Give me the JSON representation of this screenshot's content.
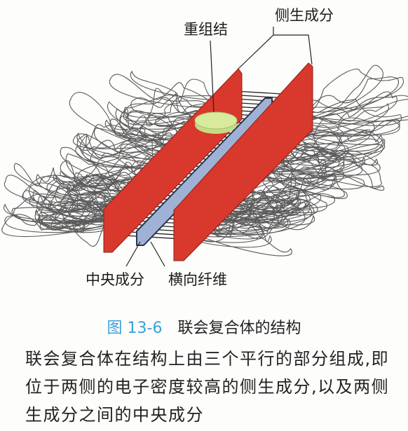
{
  "labels": {
    "recombination_nodule": "重组结",
    "lateral_element": "侧生成分",
    "central_element": "中央成分",
    "transverse_filaments": "横向纤维"
  },
  "caption": {
    "number": "图 13-6",
    "title": "联会复合体的结构"
  },
  "description": "联会复合体在结构上由三个平行的部分组成,即位于两侧的电子密度较高的侧生成分,以及两侧生成分之间的中央成分",
  "colors": {
    "lateral": "#d9382c",
    "central": "#9fb2d6",
    "nodule": "#d3e79a",
    "loops": "#555555",
    "caption_number": "#3aa0d8"
  }
}
